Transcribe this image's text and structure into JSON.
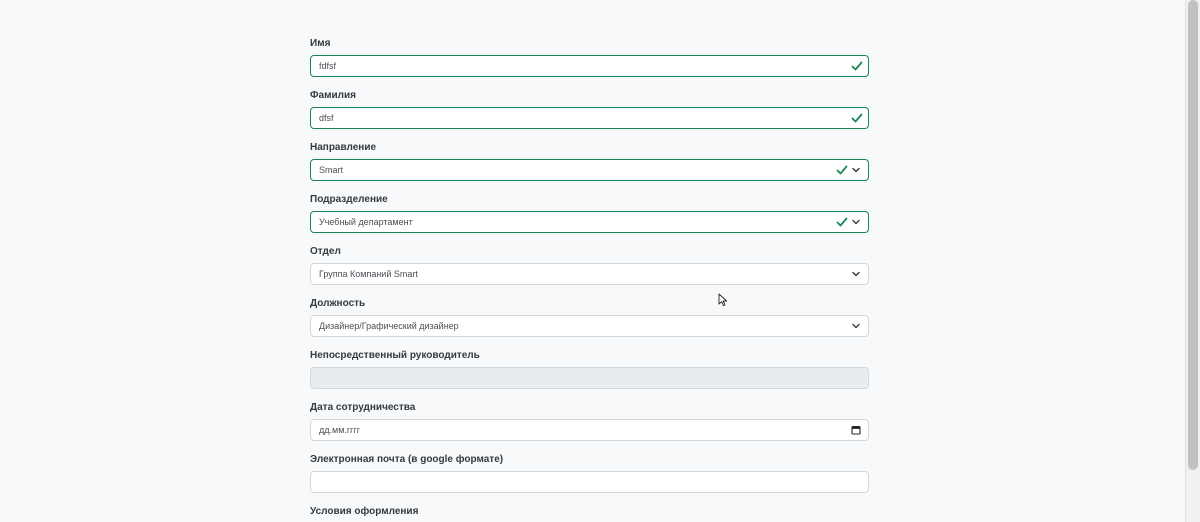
{
  "form": {
    "first_name": {
      "label": "Имя",
      "value": "fdfsf"
    },
    "last_name": {
      "label": "Фамилия",
      "value": "dfsf"
    },
    "direction": {
      "label": "Направление",
      "value": "Smart"
    },
    "subdivision": {
      "label": "Подразделение",
      "value": "Учебный департамент"
    },
    "department": {
      "label": "Отдел",
      "value": "Группа Компаний Smart"
    },
    "position": {
      "label": "Должность",
      "value": "Дизайнер/Графический дизайнер"
    },
    "manager": {
      "label": "Непосредственный руководитель",
      "value": ""
    },
    "start_date": {
      "label": "Дата сотрудничества",
      "placeholder": "дд.мм.гггг"
    },
    "email": {
      "label": "Электронная почта (в google формате)",
      "value": ""
    },
    "terms": {
      "label": "Условия оформления"
    }
  },
  "colors": {
    "valid": "#198754",
    "border": "#d4d7db",
    "disabled_bg": "#e9ecef",
    "page_bg": "#f8f9fa"
  },
  "icons": {
    "valid": "check-icon",
    "select": "chevron-down-icon",
    "date": "calendar-icon"
  }
}
